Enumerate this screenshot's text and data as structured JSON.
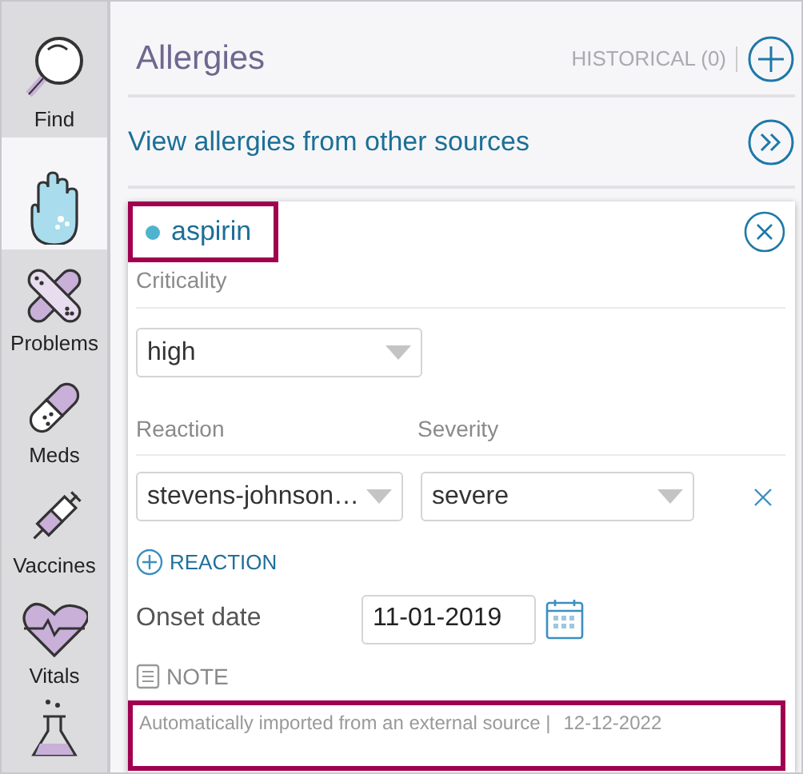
{
  "sidebar": {
    "items": [
      {
        "kind": "find",
        "label": "Find",
        "selected": false
      },
      {
        "kind": "allergies",
        "selected": true
      },
      {
        "kind": "problems",
        "label": "Problems",
        "selected": false
      },
      {
        "kind": "meds",
        "label": "Meds",
        "selected": false
      },
      {
        "kind": "vaccines",
        "label": "Vaccines",
        "selected": false
      },
      {
        "kind": "vitals",
        "label": "Vitals",
        "selected": false
      },
      {
        "kind": "lab",
        "selected": false
      }
    ]
  },
  "header": {
    "title": "Allergies",
    "historical": "HISTORICAL (0)"
  },
  "other_sources_link": "View allergies from other sources",
  "allergy": {
    "name": "aspirin",
    "color": "#4fb3cf",
    "highlighted": true,
    "criticality_label": "Criticality",
    "criticality": "high",
    "reaction_label": "Reaction",
    "severity_label": "Severity",
    "reaction": "stevens-johnson…",
    "severity": "severe",
    "add_reaction": "REACTION",
    "onset_label": "Onset date",
    "onset": "11-01-2019",
    "note_label": "NOTE",
    "note": {
      "text": "Automatically imported from an external source |",
      "date": "12-12-2022",
      "highlighted": true
    }
  }
}
